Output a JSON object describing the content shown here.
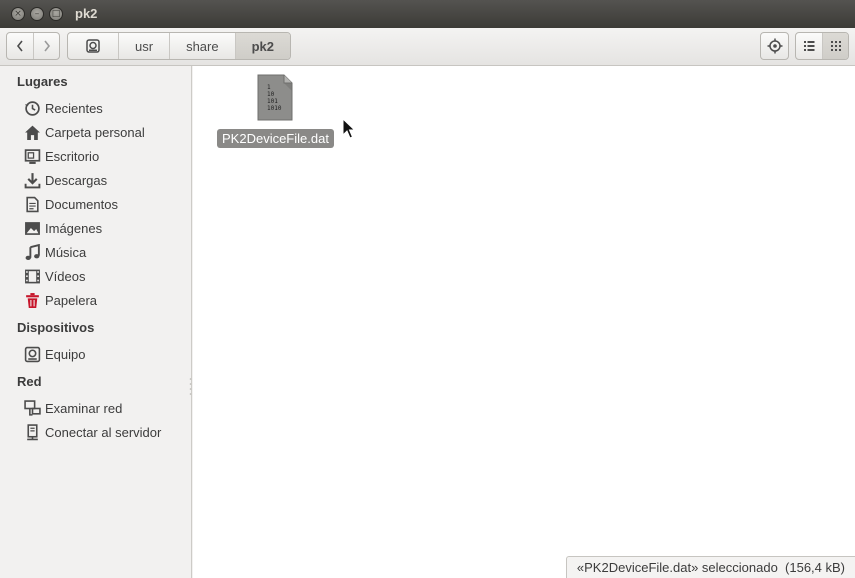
{
  "window": {
    "title": "pk2",
    "buttons": {
      "close": "×",
      "minimize": "–",
      "maximize": "□"
    }
  },
  "toolbar": {
    "back_icon": "chevron-left-icon",
    "forward_icon": "chevron-right-icon",
    "breadcrumbs": [
      {
        "label": "",
        "icon": "drive-icon"
      },
      {
        "label": "usr"
      },
      {
        "label": "share"
      },
      {
        "label": "pk2",
        "active": true
      }
    ],
    "locate_icon": "crosshair-icon",
    "view_list_icon": "list-view-icon",
    "view_grid_icon": "grid-view-icon"
  },
  "sidebar": {
    "sections": [
      {
        "title": "Lugares",
        "items": [
          {
            "label": "Recientes",
            "icon": "clock-icon"
          },
          {
            "label": "Carpeta personal",
            "icon": "home-icon"
          },
          {
            "label": "Escritorio",
            "icon": "desktop-icon"
          },
          {
            "label": "Descargas",
            "icon": "download-icon"
          },
          {
            "label": "Documentos",
            "icon": "document-icon"
          },
          {
            "label": "Imágenes",
            "icon": "image-icon"
          },
          {
            "label": "Música",
            "icon": "music-icon"
          },
          {
            "label": "Vídeos",
            "icon": "film-icon"
          },
          {
            "label": "Papelera",
            "icon": "trash-icon",
            "color": "#c7162b"
          }
        ]
      },
      {
        "title": "Dispositivos",
        "items": [
          {
            "label": "Equipo",
            "icon": "computer-icon"
          }
        ]
      },
      {
        "title": "Red",
        "items": [
          {
            "label": "Examinar red",
            "icon": "network-icon"
          },
          {
            "label": "Conectar al servidor",
            "icon": "server-icon"
          }
        ]
      }
    ]
  },
  "main": {
    "files": [
      {
        "name": "PK2DeviceFile.dat",
        "icon": "binary-file-icon",
        "selected": true,
        "icon_text": [
          "1",
          "10",
          "101",
          "1010"
        ]
      }
    ],
    "status": "«PK2DeviceFile.dat» seleccionado  (156,4 kB)"
  },
  "colors": {
    "titlebar": "#3c3b37",
    "selection": "#8a8987",
    "trash": "#c7162b"
  }
}
